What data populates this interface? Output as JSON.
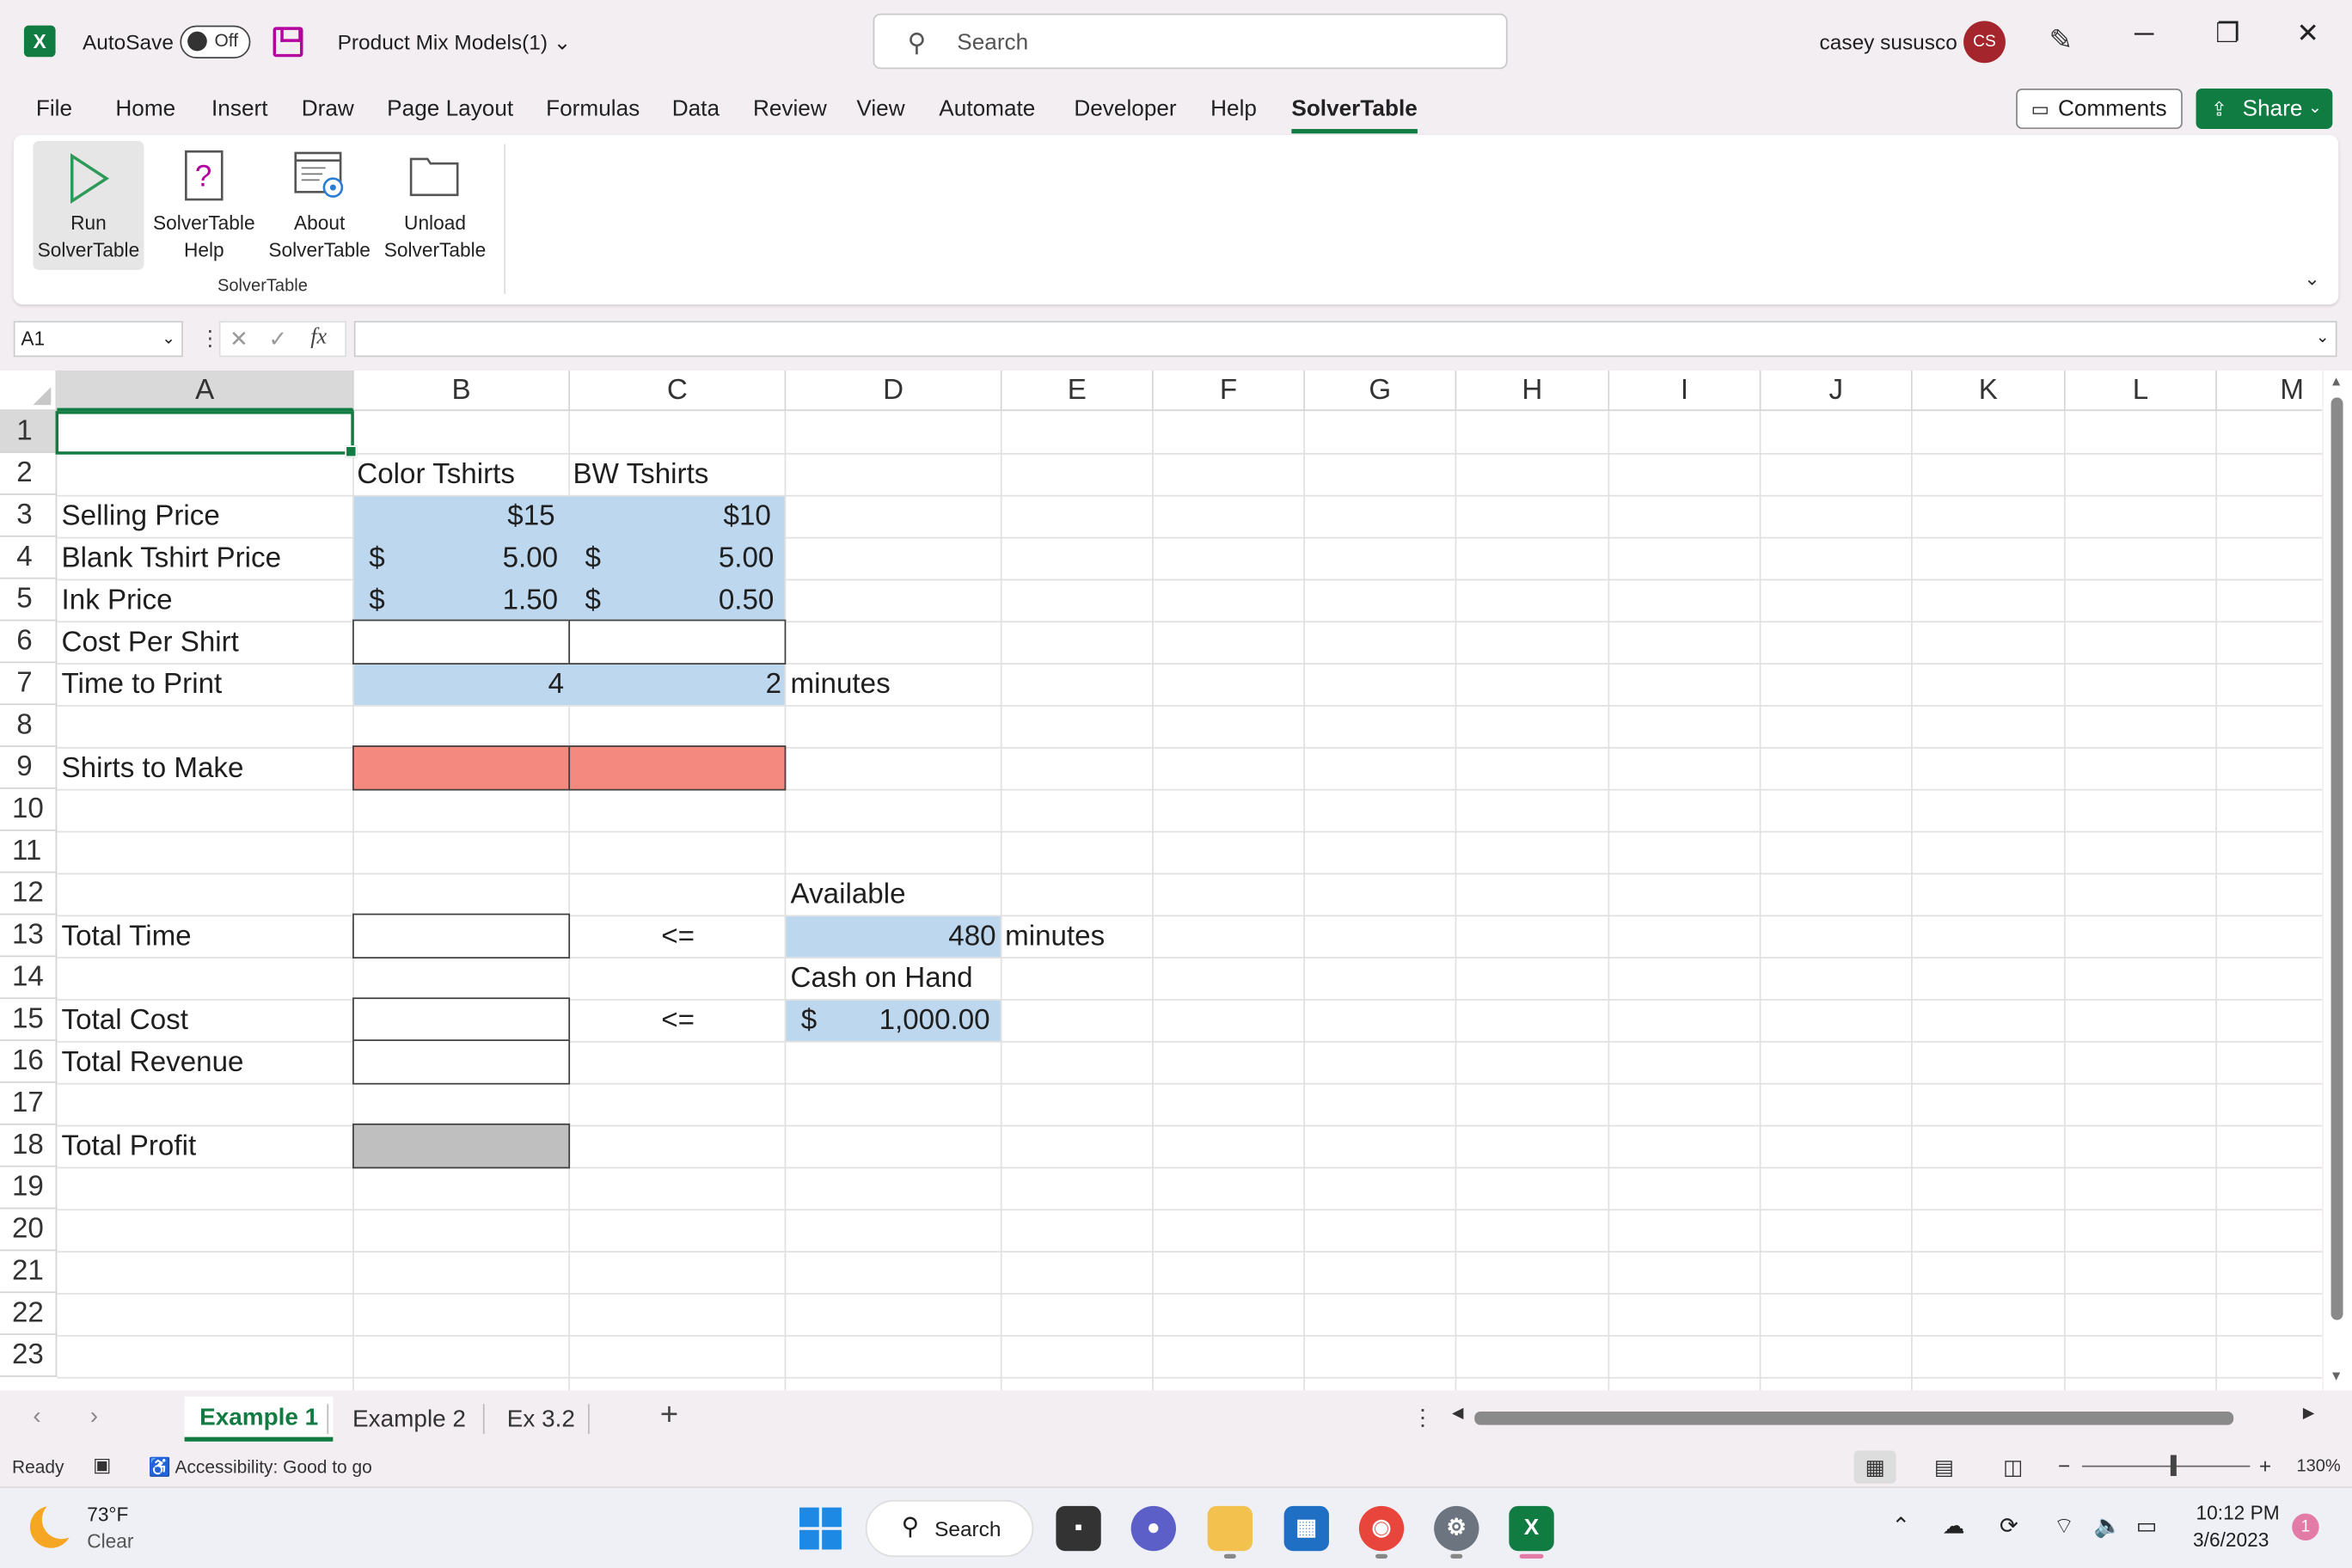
{
  "titlebar": {
    "app_icon": "excel-logo",
    "autosave_label": "AutoSave",
    "autosave_state": "Off",
    "doc_title": "Product Mix Models(1)",
    "search_placeholder": "Search",
    "user_name": "casey sususco",
    "user_initials": "CS"
  },
  "menu": {
    "items": [
      "File",
      "Home",
      "Insert",
      "Draw",
      "Page Layout",
      "Formulas",
      "Data",
      "Review",
      "View",
      "Automate",
      "Developer",
      "Help",
      "SolverTable"
    ],
    "active": "SolverTable",
    "comments_label": "Comments",
    "share_label": "Share"
  },
  "ribbon": {
    "buttons": [
      {
        "line1": "Run",
        "line2": "SolverTable",
        "icon": "play-icon"
      },
      {
        "line1": "SolverTable",
        "line2": "Help",
        "icon": "help-icon"
      },
      {
        "line1": "About",
        "line2": "SolverTable",
        "icon": "about-icon"
      },
      {
        "line1": "Unload",
        "line2": "SolverTable",
        "icon": "folder-icon"
      }
    ],
    "group_label": "SolverTable"
  },
  "formula_bar": {
    "name_box": "A1",
    "fx": "fx",
    "value": ""
  },
  "grid": {
    "columns": [
      "A",
      "B",
      "C",
      "D",
      "E",
      "F",
      "G",
      "H",
      "I",
      "J",
      "K",
      "L",
      "M"
    ],
    "rows": [
      "1",
      "2",
      "3",
      "4",
      "5",
      "6",
      "7",
      "8",
      "9",
      "10",
      "11",
      "12",
      "13",
      "14",
      "15",
      "16",
      "17",
      "18",
      "19",
      "20",
      "21",
      "22",
      "23"
    ],
    "selected_cell": "A1",
    "cells": {
      "B2": "Color Tshirts",
      "C2": "BW Tshirts",
      "A3": "Selling Price",
      "B3": "$15",
      "C3": "$10",
      "A4": "Blank Tshirt Price",
      "B4_sym": "$",
      "B4": "5.00",
      "C4_sym": "$",
      "C4": "5.00",
      "A5": "Ink Price",
      "B5_sym": "$",
      "B5": "1.50",
      "C5_sym": "$",
      "C5": "0.50",
      "A6": "Cost Per Shirt",
      "A7": "Time to Print",
      "B7": "4",
      "C7": "2",
      "D7": "minutes",
      "A9": "Shirts to Make",
      "D12": "Available",
      "A13": "Total Time",
      "C13": "<=",
      "D13": "480",
      "E13": "minutes",
      "D14": "Cash on Hand",
      "A15": "Total Cost",
      "C15": "<=",
      "D15_sym": "$",
      "D15": "1,000.00",
      "A16": "Total Revenue",
      "A18": "Total Profit"
    },
    "colors": {
      "input_fill": "#bdd7ee",
      "decision_fill": "#f4897f",
      "objective_fill": "#bfbfbf"
    }
  },
  "sheets": {
    "tabs": [
      "Example 1",
      "Example 2",
      "Ex 3.2"
    ],
    "active": "Example 1"
  },
  "status": {
    "ready": "Ready",
    "accessibility": "Accessibility: Good to go",
    "zoom": "130%",
    "zoom_level": 0.52
  },
  "taskbar": {
    "temperature": "73°F",
    "condition": "Clear",
    "search_label": "Search",
    "time": "10:12 PM",
    "date": "3/6/2023",
    "notification_count": "1"
  }
}
